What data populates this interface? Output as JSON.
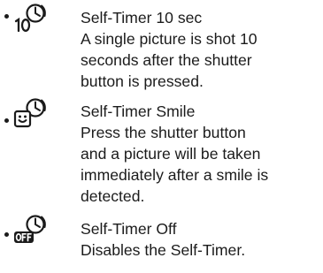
{
  "entries": [
    {
      "icon": "self-timer-10-sec-icon",
      "title": "Self-Timer 10 sec",
      "lines": [
        "A single picture is shot 10",
        "seconds after the shutter",
        "button is pressed."
      ]
    },
    {
      "icon": "self-timer-smile-icon",
      "title": "Self-Timer Smile",
      "lines": [
        "Press the shutter button",
        "and a picture will be taken",
        "immediately after a smile is",
        "detected."
      ]
    },
    {
      "icon": "self-timer-off-icon",
      "title": "Self-Timer Off",
      "lines": [
        "Disables the Self-Timer."
      ]
    }
  ]
}
